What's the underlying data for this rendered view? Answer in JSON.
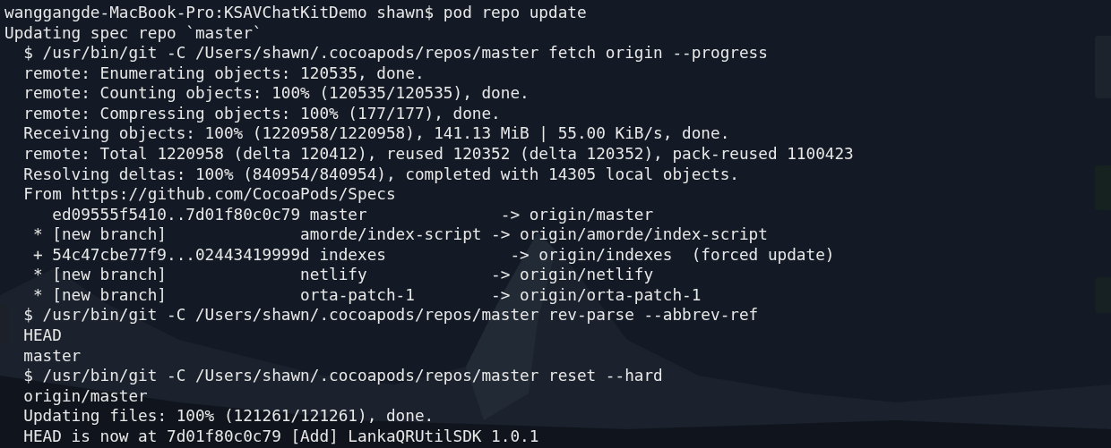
{
  "terminal": {
    "lines": [
      {
        "kind": "prompt",
        "text": "wanggangde-MacBook-Pro:KSAVChatKitDemo shawn$ pod repo update"
      },
      {
        "kind": "status",
        "text": "Updating spec repo `master`"
      },
      {
        "kind": "step",
        "text": "$ /usr/bin/git -C /Users/shawn/.cocoapods/repos/master fetch origin --progress"
      },
      {
        "kind": "step",
        "text": "remote: Enumerating objects: 120535, done."
      },
      {
        "kind": "step",
        "text": "remote: Counting objects: 100% (120535/120535), done."
      },
      {
        "kind": "step",
        "text": "remote: Compressing objects: 100% (177/177), done."
      },
      {
        "kind": "step",
        "text": "Receiving objects: 100% (1220958/1220958), 141.13 MiB | 55.00 KiB/s, done."
      },
      {
        "kind": "step",
        "text": "remote: Total 1220958 (delta 120412), reused 120352 (delta 120352), pack-reused 1100423"
      },
      {
        "kind": "step",
        "text": "Resolving deltas: 100% (840954/840954), completed with 14305 local objects."
      },
      {
        "kind": "step",
        "text": "From https://github.com/CocoaPods/Specs"
      },
      {
        "kind": "ref-plain",
        "text": "ed09555f5410..7d01f80c0c79 master              -> origin/master"
      },
      {
        "kind": "ref",
        "text": "* [new branch]              amorde/index-script -> origin/amorde/index-script"
      },
      {
        "kind": "ref",
        "text": "+ 54c47cbe77f9...02443419999d indexes             -> origin/indexes  (forced update)"
      },
      {
        "kind": "ref",
        "text": "* [new branch]              netlify             -> origin/netlify"
      },
      {
        "kind": "ref",
        "text": "* [new branch]              orta-patch-1        -> origin/orta-patch-1"
      },
      {
        "kind": "step",
        "text": "$ /usr/bin/git -C /Users/shawn/.cocoapods/repos/master rev-parse --abbrev-ref"
      },
      {
        "kind": "step",
        "text": "HEAD"
      },
      {
        "kind": "step",
        "text": "master"
      },
      {
        "kind": "step",
        "text": "$ /usr/bin/git -C /Users/shawn/.cocoapods/repos/master reset --hard"
      },
      {
        "kind": "step",
        "text": "origin/master"
      },
      {
        "kind": "step",
        "text": "Updating files: 100% (121261/121261), done."
      },
      {
        "kind": "step",
        "text": "HEAD is now at 7d01f80c0c79 [Add] LankaQRUtilSDK 1.0.1"
      }
    ]
  }
}
